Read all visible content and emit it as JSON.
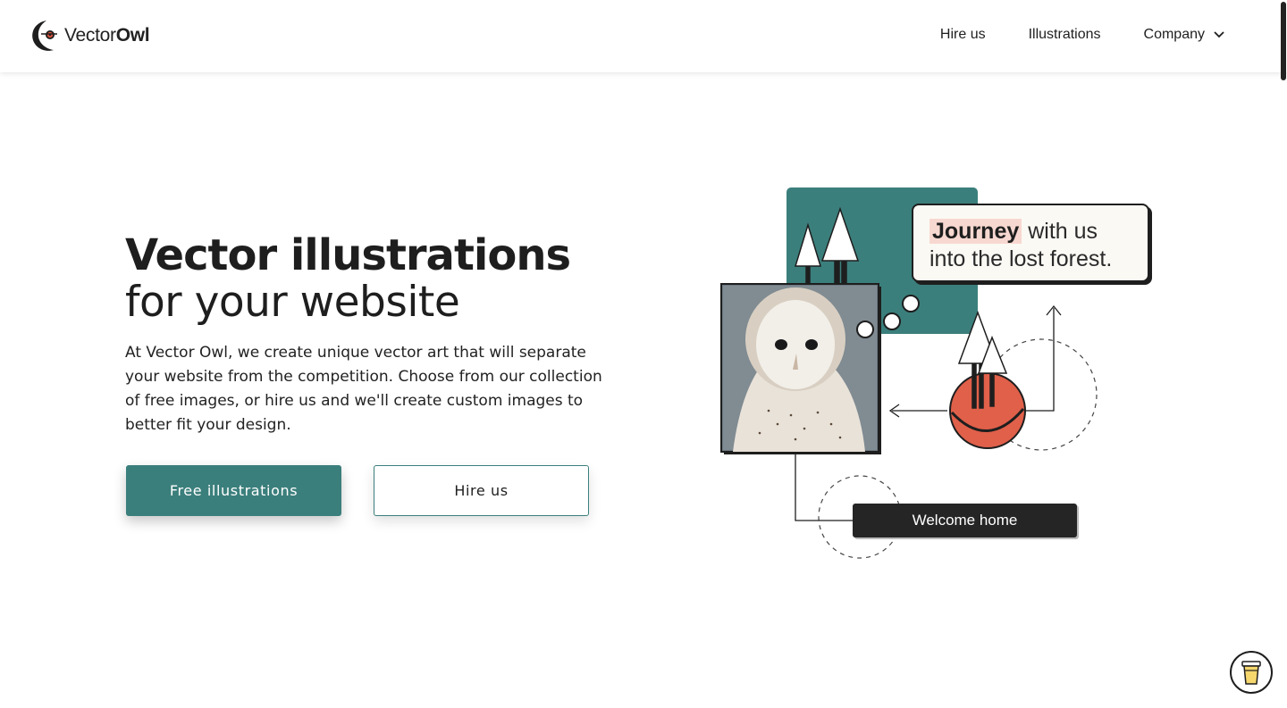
{
  "brand": {
    "word1": "Vector",
    "word2": "Owl",
    "accent": "#3b7f7c",
    "eye_color": "#d8503a"
  },
  "nav": {
    "items": [
      {
        "label": "Hire us"
      },
      {
        "label": "Illustrations"
      },
      {
        "label": "Company",
        "icon": "chevron-down-icon"
      }
    ]
  },
  "hero": {
    "title_line1": "Vector illustrations",
    "title_line2": "for your website",
    "description": "At Vector Owl, we create unique vector art that will separate your website from the competition. Choose from our collection of free images, or hire us and we'll create custom images to better fit your design.",
    "primary_button": "Free illustrations",
    "secondary_button": "Hire us"
  },
  "illustration": {
    "quote_highlight": "Journey",
    "quote_rest": "with us into the lost forest.",
    "welcome_label": "Welcome home",
    "colors": {
      "teal": "#3b7f7c",
      "coral": "#e0604a",
      "dark": "#1e1e1e",
      "highlight": "#f7d8d0"
    }
  },
  "floating": {
    "icon": "coffee-cup-icon"
  }
}
